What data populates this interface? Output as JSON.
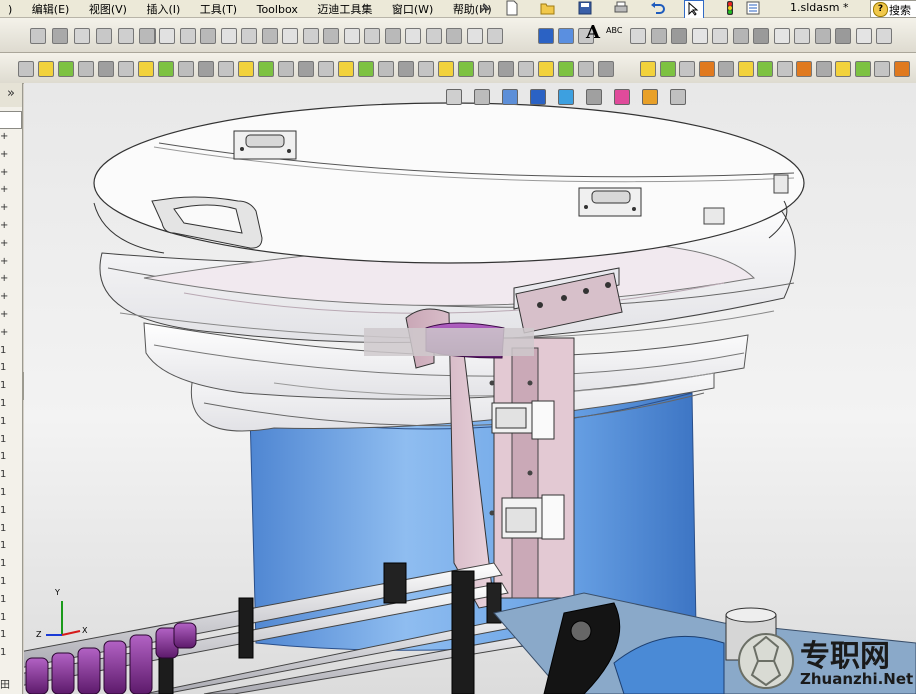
{
  "menubar": {
    "items": [
      ")",
      "编辑(E)",
      "视图(V)",
      "插入(I)",
      "工具(T)",
      "Toolbox",
      "迈迪工具集",
      "窗口(W)",
      "帮助(H)"
    ],
    "doc_title": "1.sldasm *",
    "search_label": "搜索"
  },
  "toolbar_standard": {
    "icons": [
      "new-icon",
      "open-icon",
      "save-icon",
      "print-icon",
      "undo-icon",
      "select-icon",
      "rebuild-icon",
      "options-icon"
    ]
  },
  "toolbar_sketch": {
    "text_icon": "A",
    "spell_icon": "ABC"
  },
  "colors": {
    "accent": "#316ac5",
    "bowl_white": "#f4f4f4",
    "column_blue": "#5f9ad8",
    "bracket_pink": "#d9b9c6",
    "tube_purple": "#7a2a8a"
  },
  "view_toolbar": {
    "icons": [
      "zoom-fit-icon",
      "zoom-area-icon",
      "section-view-icon",
      "view-orientation-icon",
      "display-style-icon",
      "hide-show-icon",
      "edit-appearance-icon",
      "scene-icon",
      "view-settings-icon"
    ]
  },
  "left_panel": {
    "collapse_glyph": "»",
    "rows": [
      "+",
      "+",
      "+",
      "+",
      "+",
      "+",
      "+",
      "+",
      "+",
      "+",
      "+",
      "+",
      "1",
      "1",
      "1",
      "1",
      "1",
      "1",
      "1",
      "1",
      "1",
      "1",
      "1",
      "1",
      "1",
      "1",
      "1",
      "1",
      "1",
      "1"
    ],
    "footer_glyph": "田"
  },
  "triad": {
    "y": "Y",
    "x": "X",
    "z": "Z"
  },
  "watermark": {
    "cn": "专职网",
    "en": "Zhuanzhi.Net"
  }
}
